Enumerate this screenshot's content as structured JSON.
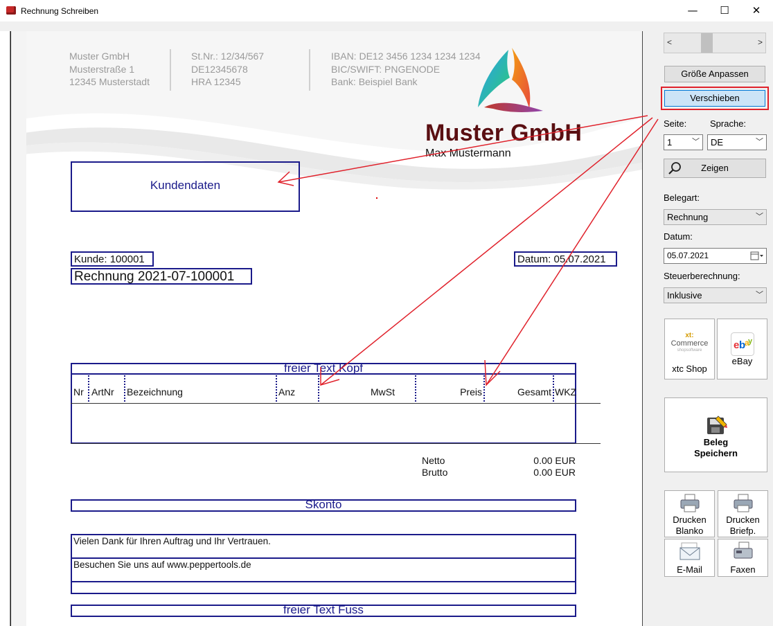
{
  "window": {
    "title": "Rechnung Schreiben",
    "minimize": "—",
    "maximize": "☐",
    "close": "✕"
  },
  "letterhead": {
    "col1": [
      "Muster GmbH",
      "Musterstraße 1",
      "12345 Musterstadt"
    ],
    "col2": [
      "St.Nr.: 12/34/567",
      "DE12345678",
      "HRA 12345"
    ],
    "col3": [
      "IBAN: DE12 3456 1234 1234 1234",
      "BIC/SWIFT: PNGENODE",
      "Bank: Beispiel Bank"
    ],
    "company": "Muster GmbH",
    "person": "Max Mustermann"
  },
  "doc": {
    "customer_box": "Kundendaten",
    "customer_no": "Kunde: 100001",
    "invoice_title": "Rechnung 2021-07-100001",
    "date": "Datum: 05.07.2021",
    "head_text": "freier Text Kopf",
    "columns": [
      "Nr",
      "ArtNr",
      "Bezeichnung",
      "Anz",
      "MwSt",
      "Preis",
      "Gesamt",
      "WKZ"
    ],
    "netto_label": "Netto",
    "netto_value": "0.00 EUR",
    "brutto_label": "Brutto",
    "brutto_value": "0.00 EUR",
    "skonto": "Skonto",
    "thanks": "Vielen Dank für Ihren Auftrag und Ihr Vertrauen.",
    "visit": "Besuchen Sie uns auf www.peppertools.de",
    "foot_text": "freier Text Fuss"
  },
  "panel": {
    "scroll_left": "<",
    "scroll_right": ">",
    "fit_button": "Größe Anpassen",
    "move_button": "Verschieben",
    "page_label": "Seite:",
    "page_value": "1",
    "lang_label": "Sprache:",
    "lang_value": "DE",
    "show_button": "Zeigen",
    "doctype_label": "Belegart:",
    "doctype_value": "Rechnung",
    "date_label": "Datum:",
    "date_value": "05.07.2021",
    "tax_label": "Steuerberechnung:",
    "tax_value": "Inklusive",
    "xtc_logo": "xt:",
    "xtc_logo2": "Commerce",
    "xtc_logo3": "shopsoftware",
    "xtc_label": "xtc Shop",
    "ebay_label": "eBay",
    "save_line1": "Beleg",
    "save_line2": "Speichern",
    "print_blank_1": "Drucken",
    "print_blank_2": "Blanko",
    "print_letter_1": "Drucken",
    "print_letter_2": "Briefp.",
    "email_label": "E-Mail",
    "fax_label": "Faxen"
  },
  "colors": {
    "highlight": "#e0212b",
    "navy": "#1a1a8a",
    "brand": "#5a0f12"
  }
}
